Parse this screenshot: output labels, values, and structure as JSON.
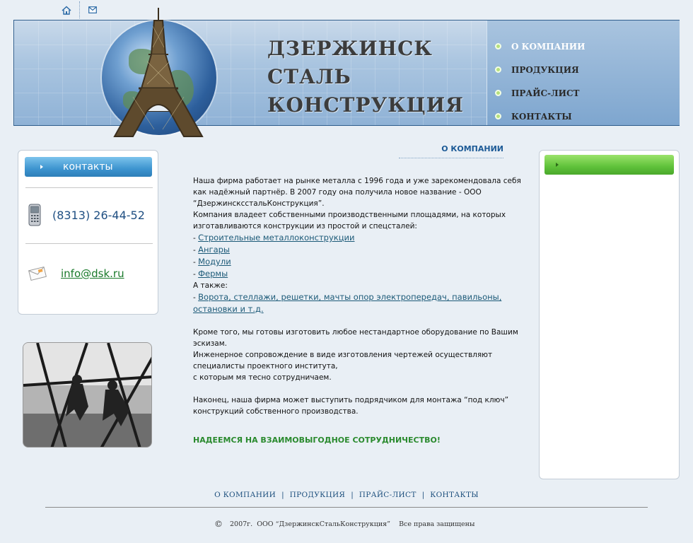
{
  "top_icons": {
    "home": "home-icon",
    "mail": "mail-icon"
  },
  "header": {
    "title_lines": [
      "ДЗЕРЖИНСК",
      "СТАЛЬ",
      "КОНСТРУКЦИЯ"
    ],
    "nav": [
      {
        "label": "О КОМПАНИИ",
        "active": true
      },
      {
        "label": "ПРОДУКЦИЯ",
        "active": false
      },
      {
        "label": "ПРАЙС-ЛИСТ",
        "active": false
      },
      {
        "label": "КОНТАКТЫ",
        "active": false
      }
    ]
  },
  "contacts_box": {
    "heading": "контакты",
    "phone": "(8313) 26-44-52",
    "email": "info@dsk.ru"
  },
  "main": {
    "section_title": "О КОМПАНИИ",
    "intro": "Наша фирма работает на рынке металла с 1996 года и уже зарекомендовала себя как надёжный партнёр. В 2007 году она получила новое название - ООО “ДзержинсксстальКонструкция”.",
    "facilities": "Компания владеет собственными производственными площадями, на которых изготавливаются конструкции из простой и спецсталей:",
    "products": [
      "Строительные металлоконструкции",
      "Ангары",
      "Модули",
      "Фермы"
    ],
    "also_label": "А также:",
    "also_link": "Ворота, стеллажи, решетки, мачты опор электропередач, павильоны, остановки и т.д.",
    "custom_1": "Кроме того, мы готовы изготовить любое нестандартное оборудование по Вашим эскизам.",
    "custom_2": "Инженерное сопровождение в виде изготовления чертежей осуществляют специалисты проектного института,",
    "custom_3": "с которым мя тесно сотрудничаем.",
    "turnkey": "Наконец, наша фирма может выступить подрядчиком для монтажа “под ключ” конструкций собственного производства.",
    "slogan": "НАДЕЕМСЯ НА ВЗАИМОВЫГОДНОЕ СОТРУДНИЧЕСТВО!"
  },
  "footer": {
    "nav": [
      "О КОМПАНИИ",
      "ПРОДУКЦИЯ",
      "ПРАЙС-ЛИСТ",
      "КОНТАКТЫ"
    ],
    "separator": "|",
    "copyright_symbol": "©",
    "copyright": "2007г.  ООО “ДзержинскСтальКонструкция”    Все права защищены"
  },
  "colors": {
    "link": "#1c5a78",
    "accent_blue": "#1c5a96",
    "accent_green": "#2a8a2e",
    "background": "#e9eff5"
  }
}
